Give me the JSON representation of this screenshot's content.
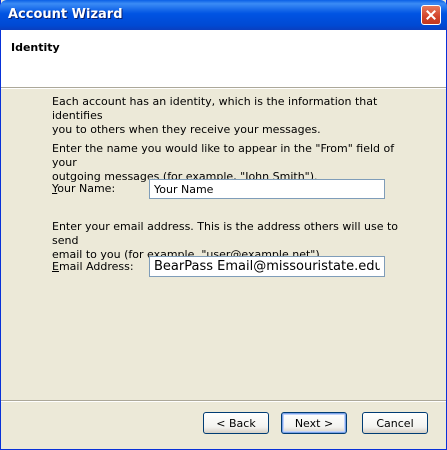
{
  "window": {
    "title": "Account Wizard"
  },
  "header": {
    "title": "Identity"
  },
  "content": {
    "intro_line1": "Each account has an identity, which is the information that identifies",
    "intro_line2": "you to others when they receive your messages.",
    "name_help_line1": "Enter the name you would like to appear in the \"From\" field of your",
    "name_help_line2": "outgoing messages (for example, \"John Smith\").",
    "name_label_first": "Y",
    "name_label_rest": "our Name:",
    "name_value": "Your Name",
    "email_help_line1": "Enter your email address. This is the address others will use to send",
    "email_help_line2": "email to you (for example, \"user@example.net\").",
    "email_label_first": "E",
    "email_label_rest": "mail Address:",
    "email_value": "BearPass Email@missouristate.edu"
  },
  "buttons": {
    "back": "< Back",
    "next": "Next >",
    "cancel": "Cancel"
  }
}
